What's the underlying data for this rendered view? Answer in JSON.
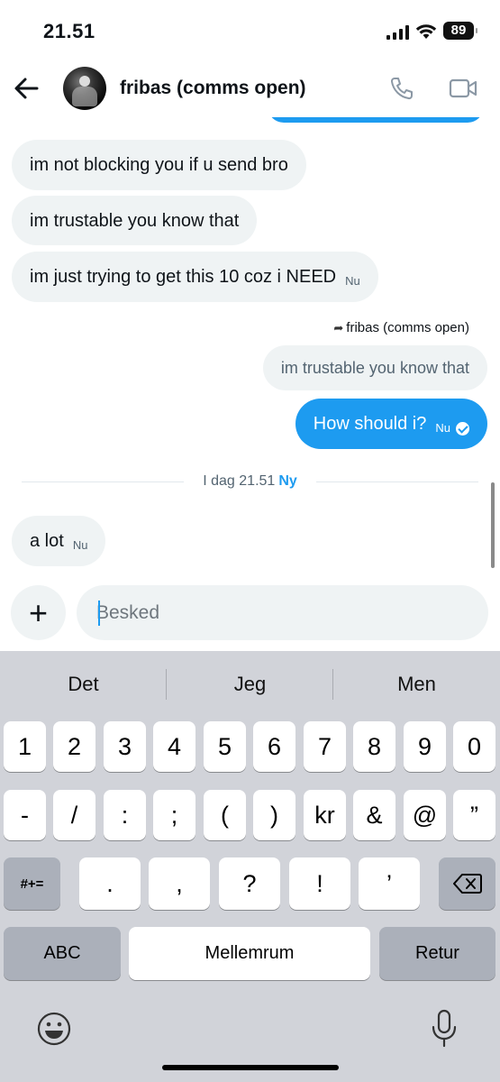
{
  "status": {
    "time": "21.51",
    "battery": "89"
  },
  "header": {
    "title": "fribas (comms open)"
  },
  "messages": {
    "m1": "im not blocking you if u send bro",
    "m2": "im trustable you know that",
    "m3": "im just trying to get this 10 coz i NEED",
    "m3_stamp": "Nu",
    "reply_to": "fribas (comms open)",
    "quoted": "im trustable you know that",
    "sent": "How should i?",
    "sent_stamp": "Nu",
    "divider": "I dag 21.51",
    "divider_new": "Ny",
    "m4": "a lot",
    "m4_stamp": "Nu"
  },
  "composer": {
    "placeholder": "Besked"
  },
  "keyboard": {
    "suggestions": [
      "Det",
      "Jeg",
      "Men"
    ],
    "row1": [
      "1",
      "2",
      "3",
      "4",
      "5",
      "6",
      "7",
      "8",
      "9",
      "0"
    ],
    "row2": [
      "-",
      "/",
      ":",
      ";",
      "(",
      ")",
      "kr",
      "&",
      "@",
      "”"
    ],
    "row3_left": "#+=",
    "row3": [
      ".",
      ",",
      "?",
      "!",
      "’"
    ],
    "abc": "ABC",
    "space": "Mellemrum",
    "return": "Retur"
  },
  "colors": {
    "accent": "#1d9bf0",
    "bubble_received": "#eff3f4",
    "keyboard_bg": "#d1d3d9"
  }
}
